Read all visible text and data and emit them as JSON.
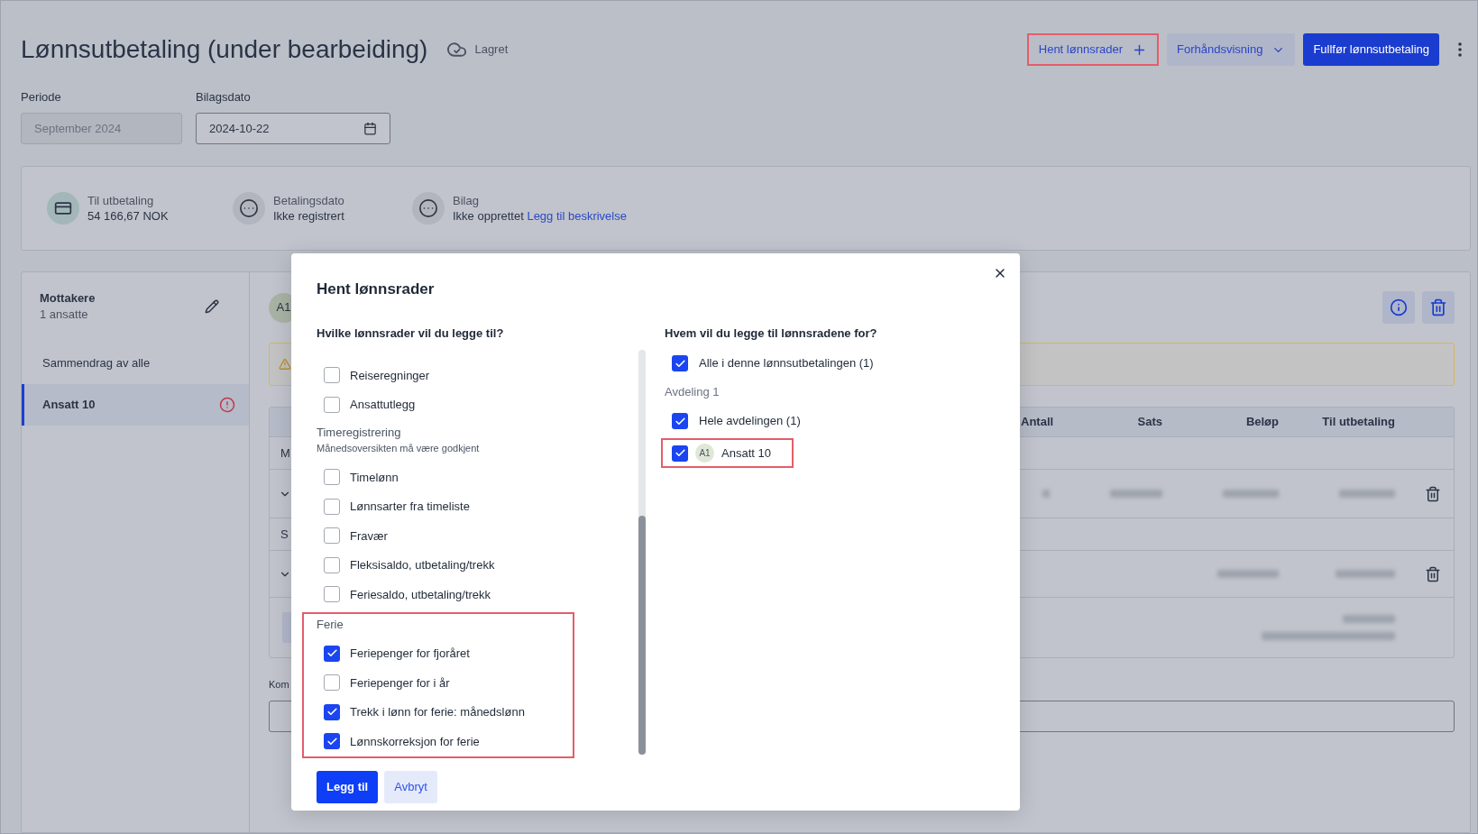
{
  "header": {
    "title": "Lønnsutbetaling (under bearbeiding)",
    "save_status": "Lagret",
    "actions": [
      {
        "kind": "add",
        "label": "Hent lønnsrader",
        "highlighted": true
      },
      {
        "kind": "dropdown",
        "label": "Forhåndsvisning",
        "highlighted": false
      },
      {
        "kind": "primary",
        "label": "Fullfør lønnsutbetaling",
        "highlighted": false
      }
    ]
  },
  "fields": [
    {
      "kind": "text",
      "label": "Periode",
      "value": "September 2024",
      "disabled": true
    },
    {
      "kind": "date",
      "label": "Bilagsdato",
      "value": "2024-10-22",
      "disabled": false
    }
  ],
  "summary": [
    {
      "kind": "card",
      "label": "Til utbetaling",
      "value": "54 166,67 NOK"
    },
    {
      "kind": "pending",
      "label": "Betalingsdato",
      "value": "Ikke registrert"
    },
    {
      "kind": "pending",
      "label": "Bilag",
      "value": "Ikke opprettet",
      "link": "Legg til beskrivelse"
    }
  ],
  "sidebar": {
    "title": "Mottakere",
    "subtitle": "1 ansatte",
    "items": [
      {
        "label": "Sammendrag av alle",
        "selected": false,
        "warning": false
      },
      {
        "label": "Ansatt 10",
        "selected": true,
        "warning": true
      }
    ]
  },
  "employee": {
    "avatar": "A1"
  },
  "table": {
    "columns": [
      "Antall",
      "Sats",
      "Beløp",
      "Til utbetaling"
    ],
    "rows": [
      {
        "kind": "group",
        "label": "M"
      },
      {
        "kind": "line"
      },
      {
        "kind": "group",
        "label": "S"
      },
      {
        "kind": "amount_line"
      },
      {
        "kind": "total"
      }
    ]
  },
  "comment": {
    "label": "Kom"
  },
  "dialog": {
    "title": "Hent lønnsrader",
    "left": {
      "heading": "Hvilke lønnsrader vil du legge til?",
      "groups": [
        {
          "highlighted": false,
          "items": [
            {
              "label": "Reiseregninger",
              "checked": false
            },
            {
              "label": "Ansattutlegg",
              "checked": false
            }
          ]
        },
        {
          "title": "Timeregistrering",
          "note": "Månedsoversikten må være godkjent",
          "highlighted": false,
          "items": [
            {
              "label": "Timelønn",
              "checked": false
            },
            {
              "label": "Lønnsarter fra timeliste",
              "checked": false
            },
            {
              "label": "Fravær",
              "checked": false
            },
            {
              "label": "Fleksisaldo, utbetaling/trekk",
              "checked": false
            },
            {
              "label": "Feriesaldo, utbetaling/trekk",
              "checked": false
            }
          ]
        },
        {
          "title": "Ferie",
          "highlighted": true,
          "items": [
            {
              "label": "Feriepenger for fjoråret",
              "checked": true
            },
            {
              "label": "Feriepenger for i år",
              "checked": false
            },
            {
              "label": "Trekk i lønn for ferie: månedslønn",
              "checked": true
            },
            {
              "label": "Lønnskorreksjon for ferie",
              "checked": true
            }
          ]
        }
      ]
    },
    "right": {
      "heading": "Hvem vil du legge til lønnsradene for?",
      "options": [
        {
          "kind": "all",
          "label": "Alle i denne lønnsutbetalingen (1)",
          "checked": true,
          "highlighted": false
        },
        {
          "kind": "section",
          "label": "Avdeling 1"
        },
        {
          "kind": "department",
          "label": "Hele avdelingen (1)",
          "checked": true,
          "highlighted": false
        },
        {
          "kind": "employee",
          "avatar": "A1",
          "label": "Ansatt 10",
          "checked": true,
          "highlighted": true
        }
      ]
    },
    "buttons": [
      {
        "kind": "primary",
        "label": "Legg til"
      },
      {
        "kind": "secondary",
        "label": "Avbryt"
      }
    ]
  }
}
